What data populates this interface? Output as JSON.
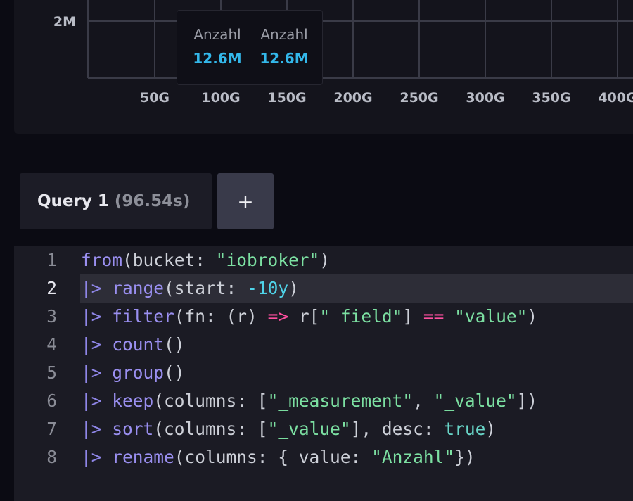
{
  "chart_data": {
    "type": "line",
    "y_tick_labels": [
      "2M"
    ],
    "x_tick_labels": [
      "50G",
      "100G",
      "150G",
      "200G",
      "250G",
      "300G",
      "350G",
      "400G"
    ],
    "grid": true
  },
  "tooltip": {
    "columns": [
      {
        "name": "Anzahl",
        "value": "12.6M"
      },
      {
        "name": "Anzahl",
        "value": "12.6M"
      }
    ]
  },
  "query_tabs": [
    {
      "label": "Query 1",
      "duration": "(96.54s)"
    }
  ],
  "add_query_label": "+",
  "editor": {
    "active_line": 2,
    "lines": [
      {
        "n": "1",
        "tokens": [
          [
            "fn",
            "from"
          ],
          [
            "pl",
            "(bucket: "
          ],
          [
            "str",
            "\"iobroker\""
          ],
          [
            "pl",
            ")"
          ]
        ]
      },
      {
        "n": "2",
        "tokens": [
          [
            "pipe",
            "|>"
          ],
          [
            "pl",
            " "
          ],
          [
            "fn",
            "range"
          ],
          [
            "pl",
            "(start: "
          ],
          [
            "num",
            "-10y"
          ],
          [
            "pl",
            ")"
          ]
        ]
      },
      {
        "n": "3",
        "tokens": [
          [
            "pipe",
            "|>"
          ],
          [
            "pl",
            " "
          ],
          [
            "fn",
            "filter"
          ],
          [
            "pl",
            "(fn: (r) "
          ],
          [
            "op",
            "=>"
          ],
          [
            "pl",
            " r["
          ],
          [
            "str",
            "\"_field\""
          ],
          [
            "pl",
            "] "
          ],
          [
            "op",
            "=="
          ],
          [
            "pl",
            " "
          ],
          [
            "str",
            "\"value\""
          ],
          [
            "pl",
            ")"
          ]
        ]
      },
      {
        "n": "4",
        "tokens": [
          [
            "pipe",
            "|>"
          ],
          [
            "pl",
            " "
          ],
          [
            "fn",
            "count"
          ],
          [
            "pl",
            "()"
          ]
        ]
      },
      {
        "n": "5",
        "tokens": [
          [
            "pipe",
            "|>"
          ],
          [
            "pl",
            " "
          ],
          [
            "fn",
            "group"
          ],
          [
            "pl",
            "()"
          ]
        ]
      },
      {
        "n": "6",
        "tokens": [
          [
            "pipe",
            "|>"
          ],
          [
            "pl",
            " "
          ],
          [
            "fn",
            "keep"
          ],
          [
            "pl",
            "(columns: ["
          ],
          [
            "str",
            "\"_measurement\""
          ],
          [
            "pl",
            ", "
          ],
          [
            "str",
            "\"_value\""
          ],
          [
            "pl",
            "])"
          ]
        ]
      },
      {
        "n": "7",
        "tokens": [
          [
            "pipe",
            "|>"
          ],
          [
            "pl",
            " "
          ],
          [
            "fn",
            "sort"
          ],
          [
            "pl",
            "(columns: ["
          ],
          [
            "str",
            "\"_value\""
          ],
          [
            "pl",
            "], desc: "
          ],
          [
            "bool",
            "true"
          ],
          [
            "pl",
            ")"
          ]
        ]
      },
      {
        "n": "8",
        "tokens": [
          [
            "pipe",
            "|>"
          ],
          [
            "pl",
            " "
          ],
          [
            "fn",
            "rename"
          ],
          [
            "pl",
            "(columns: {_value: "
          ],
          [
            "str",
            "\"Anzahl\""
          ],
          [
            "pl",
            "})"
          ]
        ]
      }
    ]
  },
  "colors": {
    "background": "#0b0b13",
    "panel": "#14141c",
    "editor": "#1b1b24",
    "accent_value": "#33b7ea",
    "grid": "#3a3b47"
  }
}
